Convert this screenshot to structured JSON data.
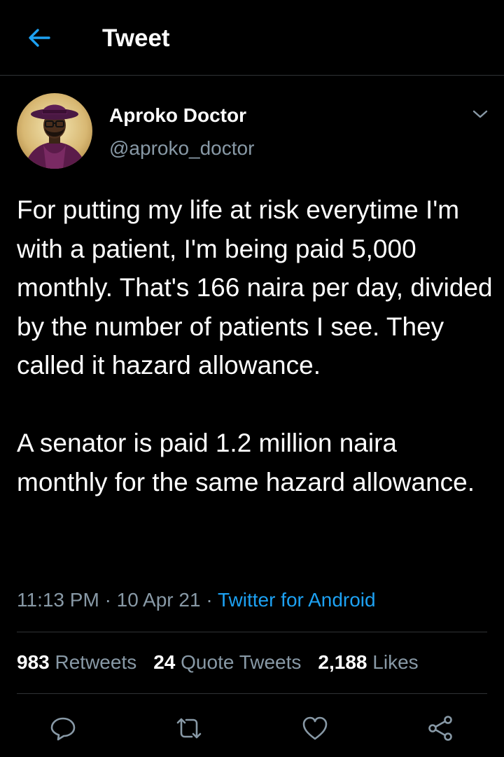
{
  "colors": {
    "background": "#000000",
    "text_primary": "#ffffff",
    "text_secondary": "#8899a6",
    "accent": "#1da1f2",
    "divider": "#2f3336"
  },
  "header": {
    "back_icon": "arrow-left-icon",
    "title": "Tweet"
  },
  "author": {
    "name": "Aproko Doctor",
    "handle": "@aproko_doctor",
    "more_icon": "chevron-down-icon"
  },
  "tweet": {
    "paragraphs": [
      "For putting my life at risk everytime I'm with a patient, I'm being paid 5,000 monthly. That's 166 naira per day, divided by the number of patients I see. They called it hazard allowance.",
      "A senator is paid 1.2 million naira monthly for the same hazard allowance."
    ],
    "time": "11:13 PM",
    "date": "10 Apr 21",
    "separator": "·",
    "source": "Twitter for Android"
  },
  "stats": {
    "retweets_count": "983",
    "retweets_label": "Retweets",
    "quotes_count": "24",
    "quotes_label": "Quote Tweets",
    "likes_count": "2,188",
    "likes_label": "Likes"
  },
  "actions": {
    "reply_icon": "reply-icon",
    "retweet_icon": "retweet-icon",
    "like_icon": "heart-icon",
    "share_icon": "share-icon"
  }
}
